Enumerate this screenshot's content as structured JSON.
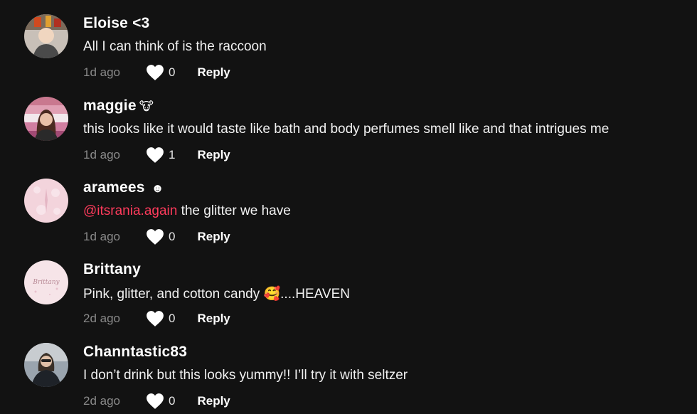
{
  "comments": [
    {
      "username": "Eloise <3",
      "badge": "",
      "mention": "",
      "text": "All I can think of is the raccoon",
      "age": "1d ago",
      "likes": "0",
      "reply": "Reply"
    },
    {
      "username": "maggie",
      "badge": "🐮",
      "mention": "",
      "text": "this looks like it would taste like bath and body perfumes smell like and that intrigues me",
      "age": "1d ago",
      "likes": "1",
      "reply": "Reply"
    },
    {
      "username": "aramees",
      "badge": "☻",
      "mention": "@itsrania.again",
      "text": " the glitter we have",
      "age": "1d ago",
      "likes": "0",
      "reply": "Reply"
    },
    {
      "username": "Brittany",
      "badge": "",
      "mention": "",
      "text": "Pink, glitter, and cotton candy 🥰....HEAVEN",
      "age": "2d ago",
      "likes": "0",
      "reply": "Reply",
      "avatar_text": "Brittany"
    },
    {
      "username": "Channtastic83",
      "badge": "",
      "mention": "",
      "text": "I don’t drink but this looks yummy!! I’ll try it with seltzer",
      "age": "2d ago",
      "likes": "0",
      "reply": "Reply"
    }
  ],
  "colors": {
    "background": "#121212",
    "mention": "#ff3b5c",
    "muted": "#8a8a8a"
  },
  "icons": {
    "like": "heart-icon"
  }
}
